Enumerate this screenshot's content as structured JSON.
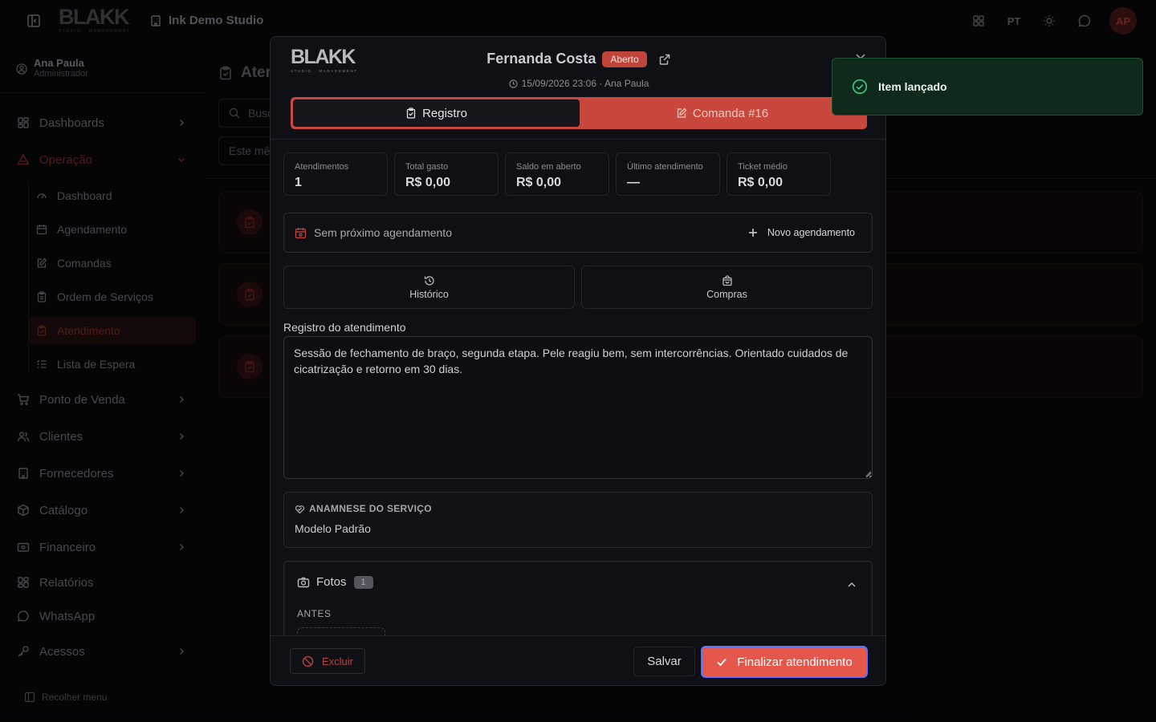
{
  "app": {
    "brand": "BLAKK",
    "brand_subtitle": "STUDIO · MANAGEMENT",
    "studio_name": "Ink Demo Studio",
    "language": "PT",
    "avatar_initials": "AP"
  },
  "user": {
    "name": "Ana Paula",
    "role": "Administrador"
  },
  "sidebar": {
    "items": [
      {
        "label": "Dashboards",
        "icon": "grid-icon"
      },
      {
        "label": "Operação",
        "icon": "warning-triangle-icon",
        "active": true
      },
      {
        "label": "Ponto de Venda",
        "icon": "cart-icon"
      },
      {
        "label": "Clientes",
        "icon": "users-icon"
      },
      {
        "label": "Fornecedores",
        "icon": "building-icon"
      },
      {
        "label": "Catálogo",
        "icon": "box-icon"
      },
      {
        "label": "Financeiro",
        "icon": "wallet-icon"
      },
      {
        "label": "Relatórios",
        "icon": "chart-icon"
      },
      {
        "label": "WhatsApp",
        "icon": "chat-icon"
      },
      {
        "label": "Acessos",
        "icon": "key-icon"
      }
    ],
    "sub_items": [
      {
        "label": "Dashboard",
        "icon": "gauge-icon"
      },
      {
        "label": "Agendamento",
        "icon": "calendar-icon"
      },
      {
        "label": "Comandas",
        "icon": "edit-icon"
      },
      {
        "label": "Ordem de Serviços",
        "icon": "clipboard-icon"
      },
      {
        "label": "Atendimento",
        "icon": "clipboard-check-icon",
        "active": true
      },
      {
        "label": "Lista de Espera",
        "icon": "list-icon"
      }
    ],
    "collapse_label": "Recolher menu"
  },
  "main": {
    "title_partial": "Ater",
    "search_partial": "Busc",
    "filter_partial": "Este mê"
  },
  "modal": {
    "client_name": "Fernanda Costa",
    "status_badge": "Aberto",
    "meta": "15/09/2026 23:06 · Ana Paula",
    "tabs": [
      {
        "label": "Registro",
        "active": true
      },
      {
        "label": "Comanda #16",
        "active": false
      }
    ],
    "stats": [
      {
        "label": "Atendimentos",
        "value": "1"
      },
      {
        "label": "Total gasto",
        "value": "R$ 0,00"
      },
      {
        "label": "Saldo em aberto",
        "value": "R$ 0,00"
      },
      {
        "label": "Último atendimento",
        "value": "—"
      },
      {
        "label": "Ticket médio",
        "value": "R$ 0,00"
      }
    ],
    "next_appointment": "Sem próximo agendamento",
    "new_appointment_label": "Novo agendamento",
    "history_label": "Histórico",
    "purchases_label": "Compras",
    "notes_label": "Registro do atendimento",
    "notes_value": "Sessão de fechamento de braço, segunda etapa. Pele reagiu bem, sem intercorrências. Orientado cuidados de cicatrização e retorno em 30 dias.",
    "anamnese_title": "ANAMNESE DO SERVIÇO",
    "anamnese_value": "Modelo Padrão",
    "photos_label": "Fotos",
    "photos_count": "1",
    "before_label": "ANTES",
    "delete_label": "Excluir",
    "save_label": "Salvar",
    "finish_label": "Finalizar atendimento"
  },
  "toast": {
    "message": "Item lançado"
  },
  "colors": {
    "accent": "#e5574b",
    "tabs_bg": "#c9473c",
    "toast_bg": "#0f291b",
    "toast_icon": "#40c47d",
    "modal_bg": "#0f0f16"
  }
}
